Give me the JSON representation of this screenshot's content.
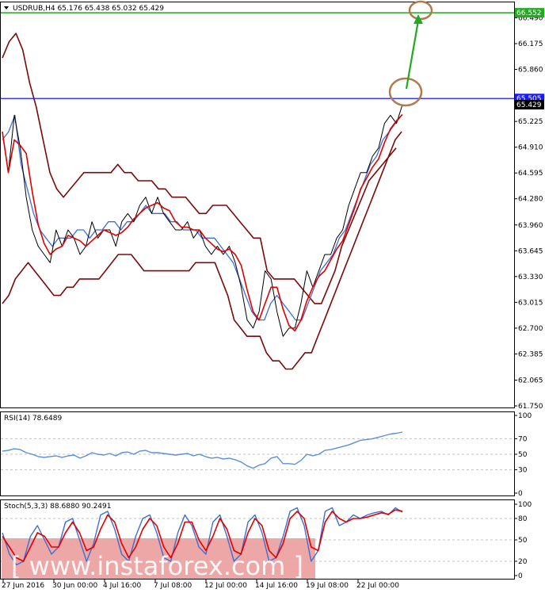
{
  "colors": {
    "price_line": "#000000",
    "bollinger": "#7a0a0a",
    "ma_fast": "#e00000",
    "ma_slow": "#3b6fd6",
    "resistance": "#1a1aff",
    "target": "#22aa22",
    "circle": "#b07a4a",
    "rsi": "#5b8fd8",
    "stoch_main": "#3b6fd6",
    "stoch_signal": "#e00000",
    "watermark_bg": "#e88a8a"
  },
  "chart_data": [
    {
      "type": "line",
      "header": "USDRUB,H4  65.176 65.438 65.032 65.429",
      "x_labels": [
        "27 Jun 2016",
        "30 Jun 00:00",
        "4 Jul 16:00",
        "7 Jul 08:00",
        "12 Jul 00:00",
        "14 Jul 16:00",
        "19 Jul 08:00",
        "22 Jul 00:00"
      ],
      "y_ticks": [
        "66.490",
        "66.175",
        "65.860",
        "65.225",
        "64.910",
        "64.595",
        "64.280",
        "63.960",
        "63.645",
        "63.330",
        "63.015",
        "62.700",
        "62.385",
        "62.065",
        "61.750"
      ],
      "ylim": [
        61.75,
        66.65
      ],
      "price_tags": {
        "target": "66.552",
        "resistance": "65.505",
        "current": "65.429"
      },
      "levels": {
        "target": 66.552,
        "resistance": 65.505
      },
      "series": [
        {
          "values": [
            65.1,
            64.6,
            65.3,
            64.9,
            64.3,
            63.9,
            63.7,
            63.6,
            63.5,
            63.9,
            63.7,
            63.9,
            63.8,
            63.6,
            63.7,
            64.0,
            63.8,
            63.9,
            63.9,
            63.7,
            64.0,
            64.1,
            64.0,
            64.2,
            64.3,
            64.1,
            64.3,
            64.1,
            64.0,
            63.9,
            63.9,
            64.0,
            63.8,
            63.9,
            63.7,
            63.6,
            63.7,
            63.6,
            63.7,
            63.5,
            63.2,
            62.8,
            62.7,
            62.9,
            63.4,
            63.3,
            62.9,
            62.6,
            62.7,
            62.7,
            63.0,
            63.4,
            63.2,
            63.4,
            63.6,
            63.6,
            63.8,
            63.9,
            64.2,
            64.4,
            64.6,
            64.6,
            64.8,
            64.9,
            65.2,
            65.3,
            65.2,
            65.43
          ]
        },
        {
          "values": [
            66.0,
            66.2,
            66.3,
            66.1,
            65.7,
            65.4,
            65.0,
            64.6,
            64.4,
            64.3,
            64.4,
            64.5,
            64.6,
            64.6,
            64.6,
            64.6,
            64.6,
            64.7,
            64.6,
            64.6,
            64.5,
            64.5,
            64.5,
            64.4,
            64.4,
            64.3,
            64.3,
            64.3,
            64.2,
            64.1,
            64.1,
            64.2,
            64.2,
            64.2,
            64.1,
            64.0,
            63.9,
            63.8,
            63.8,
            63.4,
            63.3,
            63.3,
            63.3,
            63.3,
            63.2,
            63.1,
            63.0,
            63.0,
            63.2,
            63.4,
            63.7,
            63.9,
            64.1,
            64.3,
            64.5,
            64.6,
            64.7,
            64.8,
            64.9
          ]
        },
        {
          "values": [
            65.0,
            65.1,
            65.3,
            64.7,
            64.4,
            64.1,
            63.9,
            63.8,
            63.7,
            63.8,
            63.8,
            63.8,
            63.9,
            63.9,
            63.8,
            63.9,
            63.9,
            64.0,
            64.0,
            63.9,
            64.0,
            64.0,
            64.1,
            64.2,
            64.1,
            64.1,
            64.1,
            64.0,
            64.0,
            63.9,
            63.9,
            63.9,
            63.8,
            63.8,
            63.8,
            63.7,
            63.6,
            63.5,
            63.3,
            63.1,
            62.9,
            62.8,
            62.8,
            63.0,
            63.1,
            63.0,
            62.9,
            62.8,
            62.8,
            63.0,
            63.2,
            63.4,
            63.5,
            63.6,
            63.8,
            63.9,
            64.1,
            64.3,
            64.5,
            64.7,
            64.8,
            65.0,
            65.1,
            65.2,
            65.3
          ]
        },
        {
          "values": [
            63.0,
            63.1,
            63.3,
            63.4,
            63.5,
            63.4,
            63.3,
            63.2,
            63.1,
            63.1,
            63.2,
            63.2,
            63.3,
            63.3,
            63.3,
            63.3,
            63.4,
            63.5,
            63.6,
            63.6,
            63.6,
            63.5,
            63.4,
            63.4,
            63.4,
            63.4,
            63.4,
            63.4,
            63.4,
            63.4,
            63.5,
            63.5,
            63.5,
            63.5,
            63.3,
            63.1,
            62.8,
            62.7,
            62.6,
            62.6,
            62.6,
            62.4,
            62.3,
            62.3,
            62.2,
            62.2,
            62.3,
            62.4,
            62.4,
            62.6,
            62.8,
            63.0,
            63.2,
            63.4,
            63.6,
            63.8,
            64.0,
            64.2,
            64.4,
            64.6,
            64.8,
            65.0,
            65.1
          ]
        }
      ]
    },
    {
      "type": "line",
      "header": "RSI(14) 78.6489",
      "y_ticks": [
        "100",
        "70",
        "50",
        "30",
        "0"
      ],
      "ylim": [
        0,
        100
      ],
      "series": [
        {
          "values": [
            54,
            55,
            57,
            56,
            52,
            50,
            47,
            46,
            47,
            48,
            46,
            48,
            49,
            45,
            48,
            52,
            50,
            49,
            51,
            48,
            52,
            53,
            50,
            54,
            55,
            52,
            52,
            51,
            50,
            49,
            50,
            51,
            48,
            50,
            47,
            45,
            46,
            44,
            45,
            43,
            40,
            35,
            32,
            36,
            38,
            45,
            47,
            38,
            38,
            37,
            42,
            50,
            48,
            50,
            55,
            56,
            58,
            60,
            62,
            65,
            68,
            69,
            70,
            72,
            74,
            76,
            77,
            78.6
          ]
        }
      ]
    },
    {
      "type": "line",
      "header": "Stoch(5,3,3) 88.6880 90.2491",
      "y_ticks": [
        "100",
        "80",
        "50",
        "20",
        "0"
      ],
      "ylim": [
        0,
        100
      ],
      "series": [
        {
          "values": [
            60,
            30,
            15,
            20,
            55,
            70,
            50,
            30,
            40,
            75,
            80,
            50,
            20,
            45,
            85,
            90,
            65,
            30,
            20,
            55,
            80,
            85,
            60,
            25,
            20,
            60,
            85,
            70,
            40,
            30,
            75,
            85,
            55,
            20,
            30,
            75,
            85,
            60,
            20,
            25,
            55,
            90,
            95,
            70,
            20,
            35,
            90,
            95,
            70,
            75,
            85,
            80,
            85,
            88,
            90,
            85,
            95,
            88.7
          ]
        },
        {
          "values": [
            55,
            40,
            25,
            20,
            40,
            60,
            55,
            40,
            40,
            60,
            75,
            60,
            35,
            40,
            65,
            85,
            75,
            45,
            25,
            40,
            65,
            80,
            70,
            40,
            25,
            45,
            75,
            75,
            50,
            35,
            55,
            80,
            65,
            35,
            30,
            60,
            80,
            70,
            35,
            25,
            45,
            80,
            90,
            80,
            40,
            35,
            75,
            90,
            80,
            75,
            80,
            80,
            82,
            85,
            88,
            86,
            92,
            90.2
          ]
        }
      ]
    }
  ],
  "watermark": "[ www.instaforex.com ]"
}
